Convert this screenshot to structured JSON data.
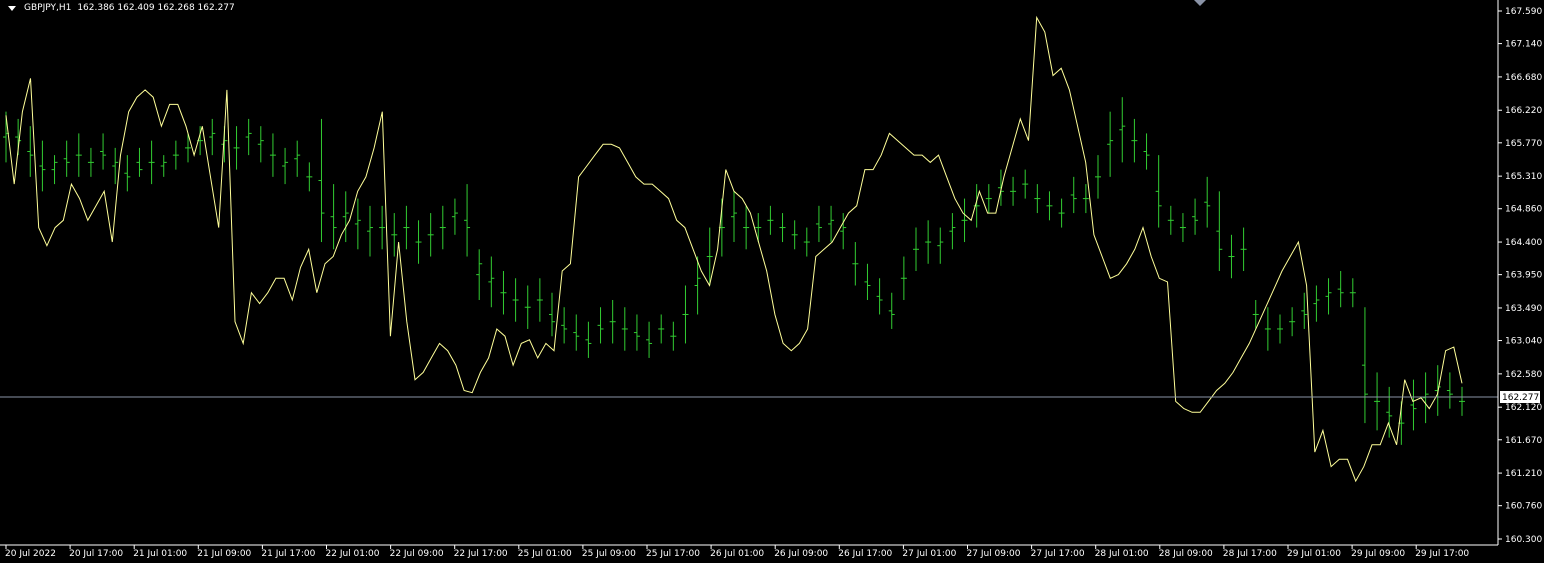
{
  "header": {
    "symbol": "GBPJPY,H1",
    "ohlc": "162.386 162.409 162.268 162.277"
  },
  "price_axis": {
    "labels": [
      "167.590",
      "167.140",
      "166.680",
      "166.220",
      "165.770",
      "165.310",
      "164.860",
      "164.400",
      "163.950",
      "163.490",
      "163.040",
      "162.580",
      "162.120",
      "161.670",
      "161.210",
      "160.760",
      "160.300"
    ],
    "current_price_label": "162.277"
  },
  "time_axis": {
    "labels": [
      "20 Jul 2022",
      "20 Jul 17:00",
      "21 Jul 01:00",
      "21 Jul 09:00",
      "21 Jul 17:00",
      "22 Jul 01:00",
      "22 Jul 09:00",
      "22 Jul 17:00",
      "25 Jul 01:00",
      "25 Jul 09:00",
      "25 Jul 17:00",
      "26 Jul 01:00",
      "26 Jul 09:00",
      "26 Jul 17:00",
      "27 Jul 01:00",
      "27 Jul 09:00",
      "27 Jul 17:00",
      "28 Jul 01:00",
      "28 Jul 09:00",
      "28 Jul 17:00",
      "29 Jul 01:00",
      "29 Jul 09:00",
      "29 Jul 17:00"
    ]
  },
  "colors": {
    "background": "#000000",
    "bars": "#32cd32",
    "indicator": "#ffff99",
    "current_price_line": "#8a93a6",
    "axis": "#ffffff",
    "price_tag_bg": "#ffffff"
  },
  "chart_data": {
    "type": "line",
    "ylim": [
      160.3,
      167.59
    ],
    "series": [
      {
        "values": [
          166.15,
          165.2,
          166.2,
          166.66,
          164.6,
          164.35,
          164.6,
          164.7,
          165.2,
          165.0,
          164.7,
          164.9,
          165.1,
          164.4,
          165.6,
          166.2,
          166.4,
          166.5,
          166.4,
          166.0,
          166.3,
          166.3,
          166.0,
          165.6,
          166.0,
          165.3,
          164.6,
          166.5,
          163.3,
          163.0,
          163.7,
          163.55,
          163.7,
          163.9,
          163.9,
          163.6,
          164.05,
          164.3,
          163.7,
          164.1,
          164.2,
          164.5,
          164.7,
          165.1,
          165.3,
          165.7,
          166.2,
          163.1,
          164.4,
          163.3,
          162.5,
          162.6,
          162.8,
          163.0,
          162.9,
          162.7,
          162.35,
          162.32,
          162.6,
          162.8,
          163.2,
          163.1,
          162.7,
          163.0,
          163.05,
          162.8,
          163.0,
          162.9,
          164.0,
          164.1,
          165.3,
          165.45,
          165.6,
          165.75,
          165.75,
          165.7,
          165.5,
          165.3,
          165.2,
          165.2,
          165.1,
          165.0,
          164.7,
          164.6,
          164.3,
          164.0,
          163.8,
          164.3,
          165.4,
          165.1,
          165.0,
          164.8,
          164.4,
          164.0,
          163.4,
          163.0,
          162.9,
          163.0,
          163.2,
          164.2,
          164.3,
          164.4,
          164.6,
          164.8,
          164.9,
          165.4,
          165.4,
          165.6,
          165.9,
          165.8,
          165.7,
          165.6,
          165.6,
          165.5,
          165.6,
          165.3,
          165.0,
          164.8,
          164.7,
          165.1,
          164.8,
          164.8,
          165.3,
          165.7,
          166.1,
          165.8,
          167.5,
          167.3,
          166.7,
          166.8,
          166.5,
          166.0,
          165.5,
          164.5,
          164.2,
          163.9,
          163.95,
          164.1,
          164.3,
          164.6,
          164.2,
          163.9,
          163.85,
          162.2,
          162.1,
          162.05,
          162.05,
          162.2,
          162.35,
          162.45,
          162.6,
          162.8,
          163.0,
          163.25,
          163.5,
          163.75,
          164.0,
          164.2,
          164.4,
          163.8,
          161.5,
          161.8,
          161.3,
          161.4,
          161.4,
          161.1,
          161.3,
          161.6,
          161.6,
          161.9,
          161.6,
          162.5,
          162.2,
          162.25,
          162.1,
          162.3,
          162.9,
          162.95,
          162.45
        ]
      },
      {
        "type": "hlc-bars",
        "values": [
          [
            166.2,
            165.5,
            165.9
          ],
          [
            166.1,
            165.6,
            165.8
          ],
          [
            166.0,
            165.3,
            165.6
          ],
          [
            165.8,
            165.1,
            165.4
          ],
          [
            165.6,
            165.2,
            165.5
          ],
          [
            165.8,
            165.3,
            165.5
          ],
          [
            165.9,
            165.3,
            165.6
          ],
          [
            165.7,
            165.3,
            165.5
          ],
          [
            165.9,
            165.4,
            165.6
          ],
          [
            165.7,
            165.2,
            165.5
          ],
          [
            165.6,
            165.1,
            165.3
          ],
          [
            165.7,
            165.3,
            165.4
          ],
          [
            165.8,
            165.2,
            165.5
          ],
          [
            165.6,
            165.3,
            165.5
          ],
          [
            165.8,
            165.4,
            165.6
          ],
          [
            165.9,
            165.5,
            165.7
          ],
          [
            166.0,
            165.6,
            165.8
          ],
          [
            166.1,
            165.6,
            165.9
          ],
          [
            166.0,
            165.5,
            165.8
          ],
          [
            166.0,
            165.4,
            165.7
          ],
          [
            166.1,
            165.6,
            165.9
          ],
          [
            166.0,
            165.5,
            165.8
          ],
          [
            165.9,
            165.3,
            165.6
          ],
          [
            165.7,
            165.2,
            165.5
          ],
          [
            165.8,
            165.3,
            165.6
          ],
          [
            165.5,
            165.1,
            165.3
          ],
          [
            166.1,
            164.4,
            164.8
          ],
          [
            165.2,
            164.3,
            164.6
          ],
          [
            165.1,
            164.4,
            164.8
          ],
          [
            165.0,
            164.3,
            164.7
          ],
          [
            164.9,
            164.2,
            164.6
          ],
          [
            164.9,
            164.3,
            164.6
          ],
          [
            164.8,
            164.2,
            164.5
          ],
          [
            164.9,
            164.3,
            164.6
          ],
          [
            164.7,
            164.1,
            164.4
          ],
          [
            164.8,
            164.2,
            164.5
          ],
          [
            164.9,
            164.3,
            164.6
          ],
          [
            165.0,
            164.5,
            164.8
          ],
          [
            165.2,
            164.2,
            164.6
          ],
          [
            164.3,
            163.6,
            164.1
          ],
          [
            164.2,
            163.5,
            163.9
          ],
          [
            164.0,
            163.4,
            163.7
          ],
          [
            163.9,
            163.3,
            163.6
          ],
          [
            163.8,
            163.2,
            163.5
          ],
          [
            163.9,
            163.3,
            163.6
          ],
          [
            163.7,
            163.1,
            163.3
          ],
          [
            163.5,
            163.0,
            163.2
          ],
          [
            163.4,
            162.9,
            163.1
          ],
          [
            163.3,
            162.8,
            163.0
          ],
          [
            163.5,
            163.0,
            163.2
          ],
          [
            163.6,
            163.0,
            163.3
          ],
          [
            163.5,
            162.9,
            163.2
          ],
          [
            163.4,
            162.9,
            163.1
          ],
          [
            163.3,
            162.8,
            163.0
          ],
          [
            163.4,
            163.0,
            163.2
          ],
          [
            163.3,
            162.9,
            163.1
          ],
          [
            163.8,
            163.0,
            163.4
          ],
          [
            164.2,
            163.4,
            163.9
          ],
          [
            164.6,
            163.8,
            164.2
          ],
          [
            165.0,
            164.2,
            164.6
          ],
          [
            165.1,
            164.4,
            164.8
          ],
          [
            164.9,
            164.3,
            164.6
          ],
          [
            164.8,
            164.4,
            164.6
          ],
          [
            164.9,
            164.5,
            164.7
          ],
          [
            164.8,
            164.4,
            164.6
          ],
          [
            164.7,
            164.3,
            164.5
          ],
          [
            164.6,
            164.2,
            164.4
          ],
          [
            164.9,
            164.4,
            164.6
          ],
          [
            164.9,
            164.4,
            164.7
          ],
          [
            164.8,
            164.3,
            164.6
          ],
          [
            164.4,
            163.8,
            164.1
          ],
          [
            164.1,
            163.6,
            163.8
          ],
          [
            163.9,
            163.4,
            163.6
          ],
          [
            163.7,
            163.2,
            163.4
          ],
          [
            164.2,
            163.6,
            163.9
          ],
          [
            164.6,
            164.0,
            164.3
          ],
          [
            164.7,
            164.1,
            164.4
          ],
          [
            164.6,
            164.1,
            164.4
          ],
          [
            164.8,
            164.3,
            164.6
          ],
          [
            165.0,
            164.4,
            164.7
          ],
          [
            165.2,
            164.6,
            164.9
          ],
          [
            165.2,
            164.8,
            165.0
          ],
          [
            165.4,
            164.9,
            165.1
          ],
          [
            165.3,
            164.9,
            165.1
          ],
          [
            165.4,
            165.0,
            165.2
          ],
          [
            165.2,
            164.8,
            165.0
          ],
          [
            165.1,
            164.7,
            164.9
          ],
          [
            165.0,
            164.6,
            164.8
          ],
          [
            165.3,
            164.8,
            165.0
          ],
          [
            165.2,
            164.8,
            165.0
          ],
          [
            165.6,
            165.0,
            165.3
          ],
          [
            166.2,
            165.3,
            165.8
          ],
          [
            166.4,
            165.5,
            166.0
          ],
          [
            166.1,
            165.5,
            165.8
          ],
          [
            165.9,
            165.4,
            165.6
          ],
          [
            165.6,
            164.6,
            164.9
          ],
          [
            164.9,
            164.5,
            164.7
          ],
          [
            164.8,
            164.4,
            164.6
          ],
          [
            165.0,
            164.5,
            164.7
          ],
          [
            165.3,
            164.6,
            164.9
          ],
          [
            165.1,
            164.0,
            164.3
          ],
          [
            164.5,
            163.9,
            164.2
          ],
          [
            164.6,
            164.0,
            164.3
          ],
          [
            163.6,
            163.2,
            163.4
          ],
          [
            163.5,
            162.9,
            163.2
          ],
          [
            163.4,
            163.0,
            163.2
          ],
          [
            163.5,
            163.1,
            163.3
          ],
          [
            163.7,
            163.2,
            163.4
          ],
          [
            163.8,
            163.3,
            163.6
          ],
          [
            163.9,
            163.4,
            163.7
          ],
          [
            164.0,
            163.5,
            163.7
          ],
          [
            163.9,
            163.5,
            163.7
          ],
          [
            163.5,
            161.9,
            162.3
          ],
          [
            162.6,
            161.8,
            162.2
          ],
          [
            162.4,
            161.7,
            162.0
          ],
          [
            162.2,
            161.6,
            161.9
          ],
          [
            162.5,
            161.8,
            162.1
          ],
          [
            162.6,
            161.9,
            162.3
          ],
          [
            162.7,
            162.0,
            162.4
          ],
          [
            162.6,
            162.1,
            162.3
          ],
          [
            162.4,
            162.0,
            162.2
          ]
        ]
      }
    ]
  }
}
